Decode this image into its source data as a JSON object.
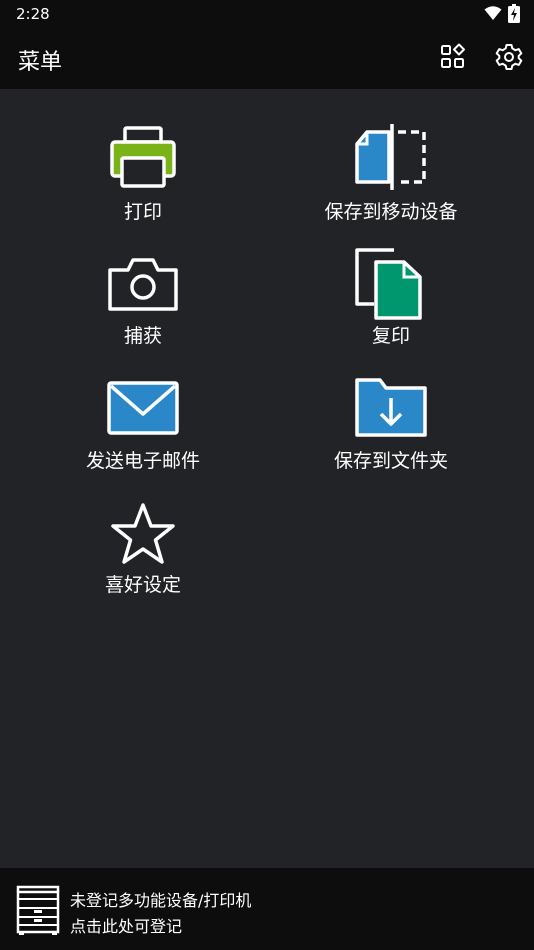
{
  "status_bar": {
    "time": "2:28"
  },
  "app_bar": {
    "title": "菜单",
    "apps_icon": "apps-icon",
    "settings_icon": "gear-icon"
  },
  "menu": {
    "items": [
      {
        "label": "打印",
        "icon": "print-icon"
      },
      {
        "label": "保存到移动设备",
        "icon": "save-to-mobile-icon"
      },
      {
        "label": "捕获",
        "icon": "camera-icon"
      },
      {
        "label": "复印",
        "icon": "copy-icon"
      },
      {
        "label": "发送电子邮件",
        "icon": "mail-icon"
      },
      {
        "label": "保存到文件夹",
        "icon": "folder-download-icon"
      },
      {
        "label": "喜好设定",
        "icon": "star-icon"
      }
    ]
  },
  "footer": {
    "line1": "未登记多功能设备/打印机",
    "line2": "点击此处可登记",
    "icon": "multifunction-printer-icon"
  },
  "colors": {
    "background": "#222326",
    "bar": "#0d0d0d",
    "accent_blue": "#2a88c8",
    "accent_green": "#7ab317",
    "accent_teal": "#00966e"
  }
}
